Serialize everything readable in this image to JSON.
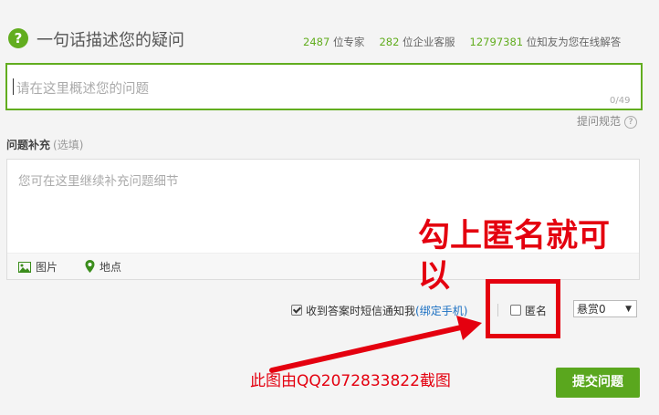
{
  "header": {
    "title": "一句话描述您的疑问",
    "help_icon": "question-circle-icon",
    "stats": [
      {
        "number": "2487",
        "label": "位专家"
      },
      {
        "number": "282",
        "label": "位企业客服"
      },
      {
        "number": "12797381",
        "label": "位知友为您在线解答"
      }
    ]
  },
  "question": {
    "placeholder": "请在这里概述您的问题",
    "counter": "0/49",
    "rules_link": "提问规范",
    "rules_icon": "?"
  },
  "supplement": {
    "label": "问题补充",
    "optional": "(选填)",
    "placeholder": "您可在这里继续补充问题细节",
    "toolbar": {
      "image_label": "图片",
      "image_icon": "image-icon",
      "location_label": "地点",
      "location_icon": "map-pin-icon"
    }
  },
  "options": {
    "sms_notify_label": "收到答案时短信通知我",
    "sms_notify_checked": true,
    "bind_phone_link": "(绑定手机)",
    "anonymous_label": "匿名",
    "anonymous_checked": false,
    "reward_value": "悬赏0"
  },
  "submit_label": "提交问题",
  "annotation": {
    "instruction": "勾上匿名就可以",
    "credit": "此图由QQ2072833822截图",
    "color": "#e4000f"
  },
  "colors": {
    "accent_green": "#62ad1f",
    "link_blue": "#1a6fc2"
  }
}
